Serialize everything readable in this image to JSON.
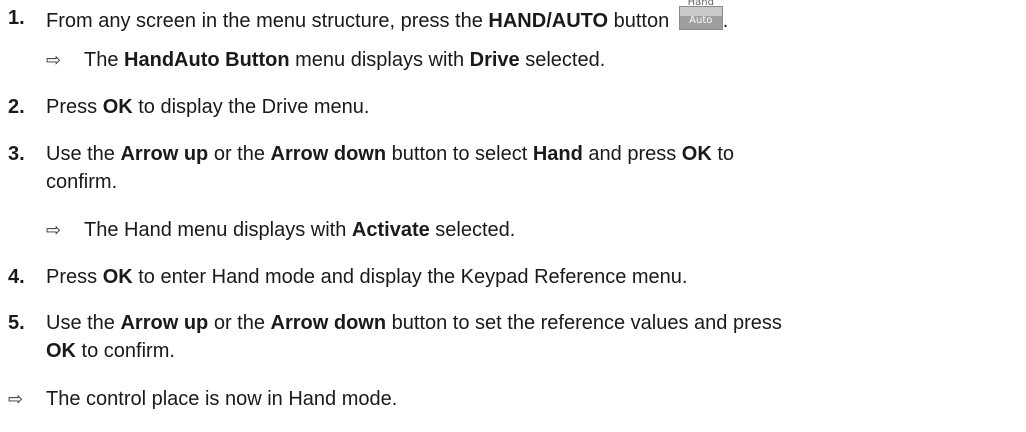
{
  "steps": [
    {
      "number": "1.",
      "parts": [
        "From any screen in the menu structure, press the ",
        "HAND/AUTO",
        " button "
      ],
      "button_icon": {
        "top": "Hand",
        "bottom": "Auto",
        "name": "hand-auto-button-icon"
      },
      "trailing": ".",
      "result": [
        "The ",
        "HandAuto Button",
        " menu displays with ",
        "Drive",
        " selected."
      ]
    },
    {
      "number": "2.",
      "parts": [
        "Press ",
        "OK",
        " to display the Drive menu."
      ]
    },
    {
      "number": "3.",
      "parts": [
        "Use the ",
        "Arrow up",
        " or the ",
        "Arrow down",
        " button to select ",
        "Hand",
        " and press ",
        "OK",
        " to"
      ],
      "continuation": "confirm.",
      "result": [
        "The Hand menu displays with ",
        "Activate",
        " selected."
      ]
    },
    {
      "number": "4.",
      "parts": [
        "Press ",
        "OK",
        " to enter Hand mode and display the Keypad Reference menu."
      ]
    },
    {
      "number": "5.",
      "parts": [
        "Use the ",
        "Arrow up",
        " or the ",
        "Arrow down",
        " button to set the reference values and press"
      ],
      "continuation_parts": [
        "OK",
        " to confirm."
      ]
    }
  ],
  "final_result": "The control place is now in Hand mode.",
  "arrow_glyph": "⇨"
}
